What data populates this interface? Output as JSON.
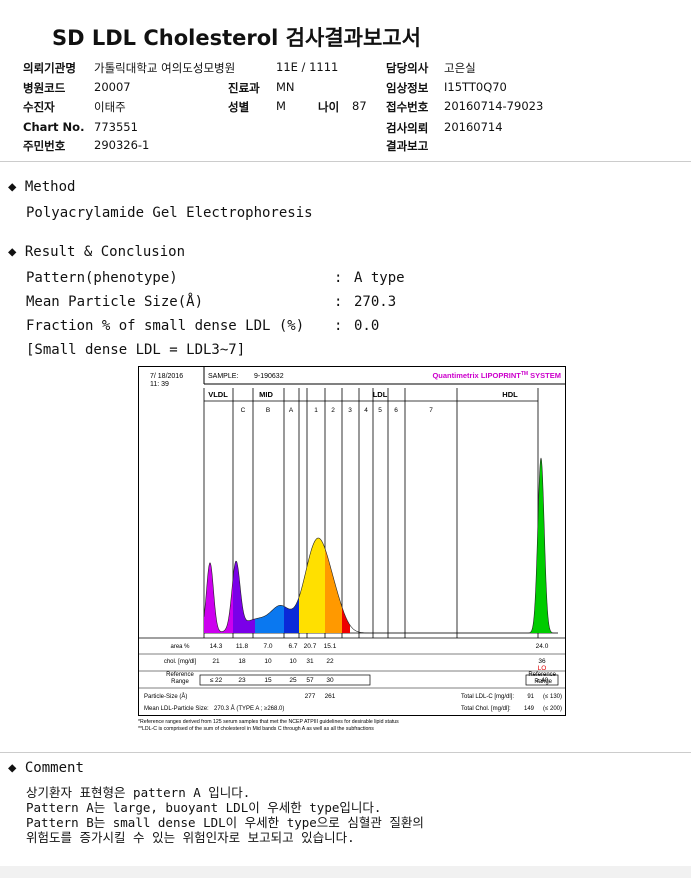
{
  "report": {
    "title": "SD LDL Cholesterol 검사결과보고서"
  },
  "header": {
    "inst_label": "의뢰기관명",
    "inst_value": "가톨릭대학교 여의도성모병원",
    "ward_value": "11E / 1111",
    "doctor_label": "담당의사",
    "doctor_value": "고은실",
    "code_label": "병원코드",
    "code_value": "20007",
    "dept_label": "진료과",
    "dept_value": "MN",
    "clinical_label": "임상정보",
    "clinical_value": "I15TT0Q70",
    "patient_label": "수진자",
    "patient_value": "이태주",
    "sex_label": "성별",
    "sex_value": "M",
    "age_label": "나이",
    "age_value": "87",
    "receipt_label": "접수번호",
    "receipt_value": "20160714-79023",
    "chart_label": "Chart No.",
    "chart_value": "773551",
    "request_label": "검사의뢰",
    "request_value": "20160714",
    "id_label": "주민번호",
    "id_value": "290326-1",
    "result_label": "결과보고"
  },
  "method": {
    "heading": "Method",
    "text": "Polyacrylamide Gel Electrophoresis",
    "bullet_icon": "diamond-icon"
  },
  "result": {
    "heading": "Result & Conclusion",
    "rows": [
      {
        "label": "Pattern(phenotype)",
        "value": "A type"
      },
      {
        "label": "Mean Particle Size(Å)",
        "value": "270.3"
      },
      {
        "label": "Fraction % of small dense LDL (%)",
        "value": "0.0"
      }
    ],
    "colon": ":",
    "note": "[Small dense LDL = LDL3~7]"
  },
  "chart_data": {
    "type": "area",
    "datetime": "7/ 18/2016\n11: 39",
    "date": "7/ 18/2016",
    "time": "11: 39",
    "sample_label": "SAMPLE:",
    "sample_value": "9-190632",
    "brand_a": "Quantimetrix ",
    "brand_b": "LIPOPRINT",
    "brand_tm": "TM",
    "brand_c": " SYSTEM",
    "brand_color": "#cc00cc",
    "groups": [
      "VLDL",
      "MID",
      "LDL",
      "HDL"
    ],
    "bands": [
      "C",
      "B",
      "A",
      "1",
      "2",
      "3",
      "4",
      "5",
      "6",
      "7"
    ],
    "fractions": [
      {
        "name": "VLDL",
        "area": "14.3",
        "chol": "21",
        "ref": "≤ 22",
        "color": "#cc00ee"
      },
      {
        "name": "MID C",
        "area": "11.8",
        "chol": "18",
        "ref": "23",
        "color": "#7a00e8"
      },
      {
        "name": "MID B",
        "area": "7.0",
        "chol": "10",
        "ref": "15",
        "color": "#0a78f0"
      },
      {
        "name": "MID A",
        "area": "6.7",
        "chol": "10",
        "ref": "25",
        "color": "#0a2ad8"
      },
      {
        "name": "LDL 1",
        "area": "20.7",
        "chol": "31",
        "ref": "57",
        "color": "#ffe000"
      },
      {
        "name": "LDL 2",
        "area": "15.1",
        "chol": "22",
        "ref": "30",
        "color": "#ff9900"
      },
      {
        "name": "HDL",
        "area": "24.0",
        "chol": "36",
        "ref": "≥ 40",
        "color": "#00cc00"
      }
    ],
    "hdl_flag": "LO",
    "row_labels": {
      "area": "area %",
      "chol": "chol. [mg/dl]",
      "ref": "Reference Range",
      "ref_line1": "Reference",
      "ref_line2": "Range",
      "particle": "Particle-Size (Å)",
      "mean": "Mean LDL-Particle Size:"
    },
    "particle_sizes": [
      "277",
      "261"
    ],
    "mean_size_text": "270.3 Å  (TYPE A ; ≥268.0)",
    "total_ldl_label": "Total LDL-C [mg/dl]:",
    "total_ldl_value": "91",
    "total_ldl_ref": "(≤ 130)",
    "total_chol_label": "Total Chol. [mg/dl]:",
    "total_chol_value": "149",
    "total_chol_ref": "(≤ 200)",
    "footnote1": "*Reference ranges derived from 125 serum samples that met the NCEP ATPIII guidelines for desirable lipid status",
    "footnote2": "**LDL-C is comprised of the sum of cholesterol in Mid bands C through A as well as all the subfractions",
    "peaks": [
      {
        "name": "VLDL",
        "relative_height": 0.4
      },
      {
        "name": "MID C",
        "relative_height": 0.38
      },
      {
        "name": "MID B",
        "relative_height": 0.12
      },
      {
        "name": "LDL 1",
        "relative_height": 0.54
      },
      {
        "name": "HDL",
        "relative_height": 1.0
      }
    ]
  },
  "comment": {
    "heading": "Comment",
    "lines": [
      "상기환자 표현형은 pattern A 입니다.",
      "Pattern A는 large, buoyant LDL이 우세한 type입니다.",
      "Pattern B는 small dense LDL이 우세한 type으로 심혈관 질환의",
      "위험도를 증가시킬 수 있는 위험인자로 보고되고 있습니다."
    ]
  }
}
